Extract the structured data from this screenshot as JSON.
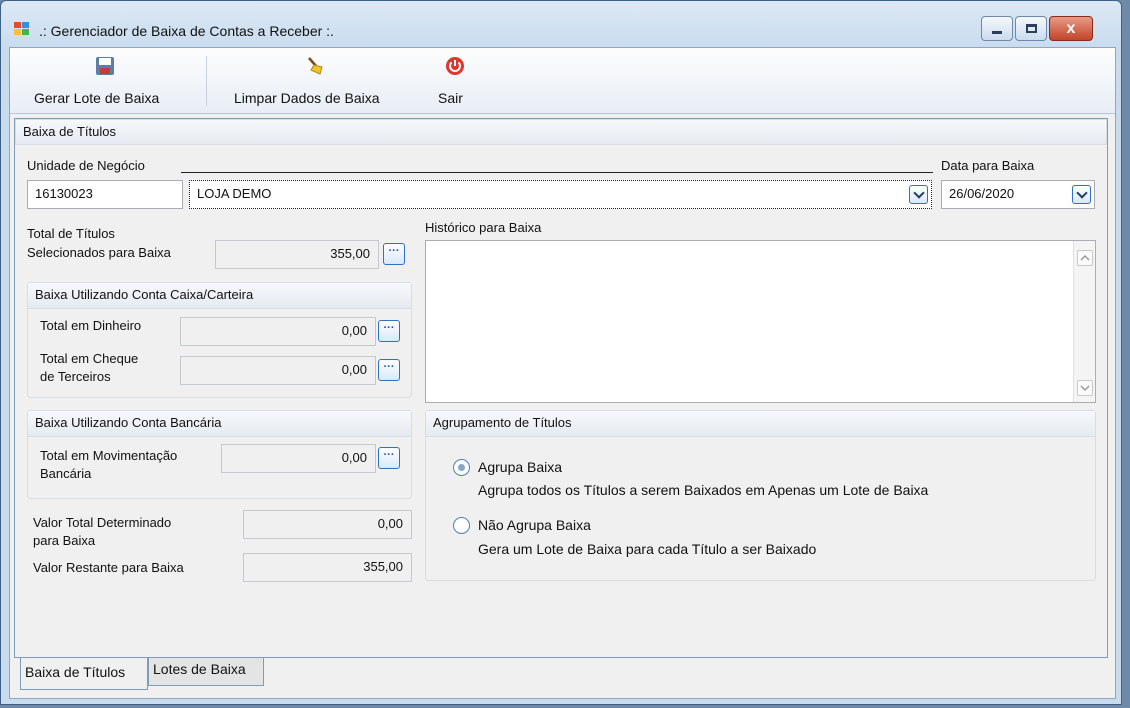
{
  "window": {
    "title": ".: Gerenciador de Baixa de Contas a Receber :.",
    "close_glyph": "x"
  },
  "toolbar": {
    "generate_label": "Gerar Lote de Baixa",
    "clear_label": "Limpar Dados de Baixa",
    "exit_label": "Sair"
  },
  "main": {
    "section_title": "Baixa de Títulos",
    "business_unit": {
      "label": "Unidade de Negócio",
      "code": "16130023",
      "name": "LOJA DEMO"
    },
    "date": {
      "label": "Data para Baixa",
      "value": "26/06/2020"
    },
    "total_selected": {
      "label_line1": "Total de Títulos",
      "label_line2": "Selecionados para Baixa",
      "value": "355,00"
    },
    "history": {
      "label": "Histórico para Baixa",
      "value": ""
    },
    "cash_group": {
      "title": "Baixa Utilizando Conta Caixa/Carteira",
      "cash_label": "Total em Dinheiro",
      "cash_value": "0,00",
      "cheque_label_line1": "Total em Cheque",
      "cheque_label_line2": "de Terceiros",
      "cheque_value": "0,00"
    },
    "bank_group": {
      "title": "Baixa Utilizando Conta Bancária",
      "label_line1": "Total em Movimentação",
      "label_line2": "Bancária",
      "value": "0,00"
    },
    "determined": {
      "label_line1": "Valor Total Determinado",
      "label_line2": "para Baixa",
      "value": "0,00"
    },
    "remaining": {
      "label": "Valor Restante para Baixa",
      "value": "355,00"
    },
    "grouping": {
      "title": "Agrupamento de Títulos",
      "option1_label": "Agrupa Baixa",
      "option1_desc": "Agrupa todos os Títulos a serem Baixados em Apenas um Lote de Baixa",
      "option2_label": "Não Agrupa Baixa",
      "option2_desc": "Gera um Lote de Baixa para cada Título a ser Baixado",
      "selected": "Agrupa Baixa"
    }
  },
  "tabs": [
    {
      "label": "Baixa de Títulos",
      "active": true
    },
    {
      "label": "Lotes de Baixa",
      "active": false
    }
  ],
  "ellipsis": "···",
  "colors": {
    "accent": "#2f72c4",
    "title_bar": "#c9dcee",
    "close_button": "#c3442a"
  }
}
